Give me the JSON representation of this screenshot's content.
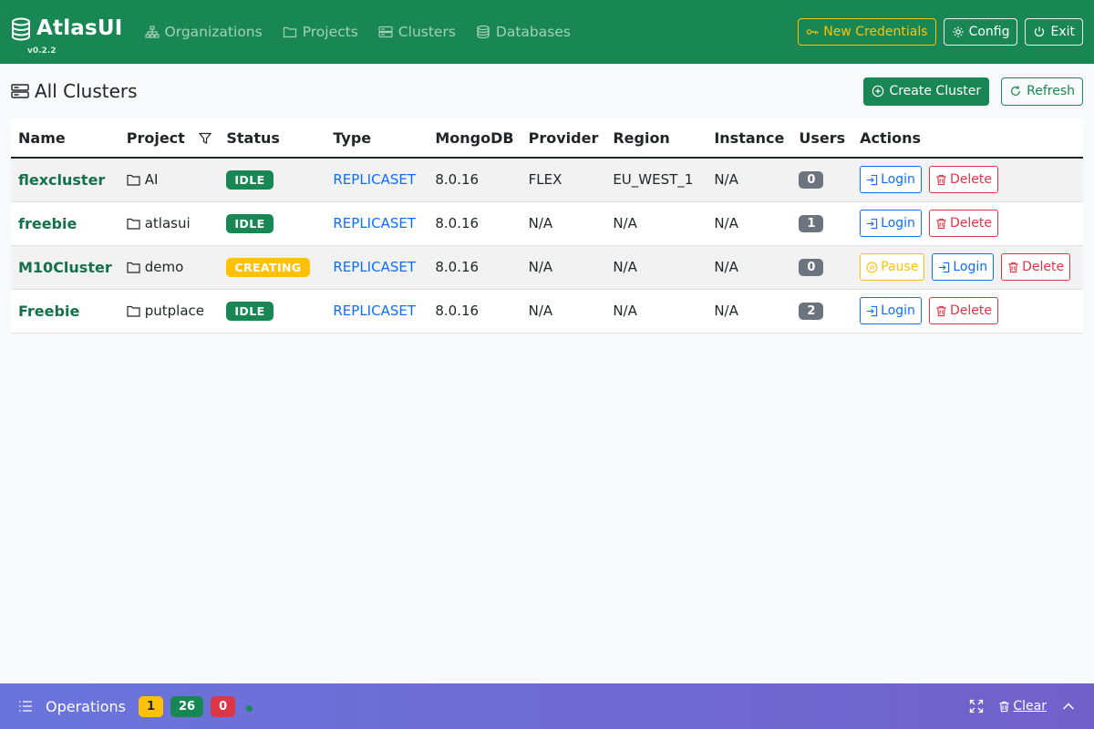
{
  "app": {
    "name": "AtlasUI",
    "version": "v0.2.2"
  },
  "nav": {
    "items": [
      {
        "label": "Organizations",
        "icon": "diagram-icon"
      },
      {
        "label": "Projects",
        "icon": "folder-icon"
      },
      {
        "label": "Clusters",
        "icon": "server-icon"
      },
      {
        "label": "Databases",
        "icon": "database-icon"
      }
    ],
    "new_credentials": "New Credentials",
    "config": "Config",
    "exit": "Exit"
  },
  "page": {
    "title": "All Clusters",
    "create_button": "Create Cluster",
    "refresh_button": "Refresh"
  },
  "table": {
    "headers": [
      "Name",
      "Project",
      "Status",
      "Type",
      "MongoDB",
      "Provider",
      "Region",
      "Instance",
      "Users",
      "Actions"
    ],
    "rows": [
      {
        "name": "flexcluster",
        "project": "AI",
        "status": "IDLE",
        "type": "REPLICASET",
        "mongodb": "8.0.16",
        "provider": "FLEX",
        "region": "EU_WEST_1",
        "instance": "N/A",
        "users": "0"
      },
      {
        "name": "freebie",
        "project": "atlasui",
        "status": "IDLE",
        "type": "REPLICASET",
        "mongodb": "8.0.16",
        "provider": "N/A",
        "region": "N/A",
        "instance": "N/A",
        "users": "1"
      },
      {
        "name": "M10Cluster",
        "project": "demo",
        "status": "CREATING",
        "type": "REPLICASET",
        "mongodb": "8.0.16",
        "provider": "N/A",
        "region": "N/A",
        "instance": "N/A",
        "users": "0"
      },
      {
        "name": "Freebie",
        "project": "putplace",
        "status": "IDLE",
        "type": "REPLICASET",
        "mongodb": "8.0.16",
        "provider": "N/A",
        "region": "N/A",
        "instance": "N/A",
        "users": "2"
      }
    ],
    "actions": {
      "login": "Login",
      "delete": "Delete",
      "pause": "Pause"
    }
  },
  "operations": {
    "title": "Operations",
    "pending": "1",
    "completed": "26",
    "failed": "0",
    "clear": "Clear"
  },
  "colors": {
    "primary": "#198754",
    "warning": "#ffc107",
    "danger": "#dc3545",
    "link": "#0d6efd",
    "secondary": "#6c757d"
  }
}
